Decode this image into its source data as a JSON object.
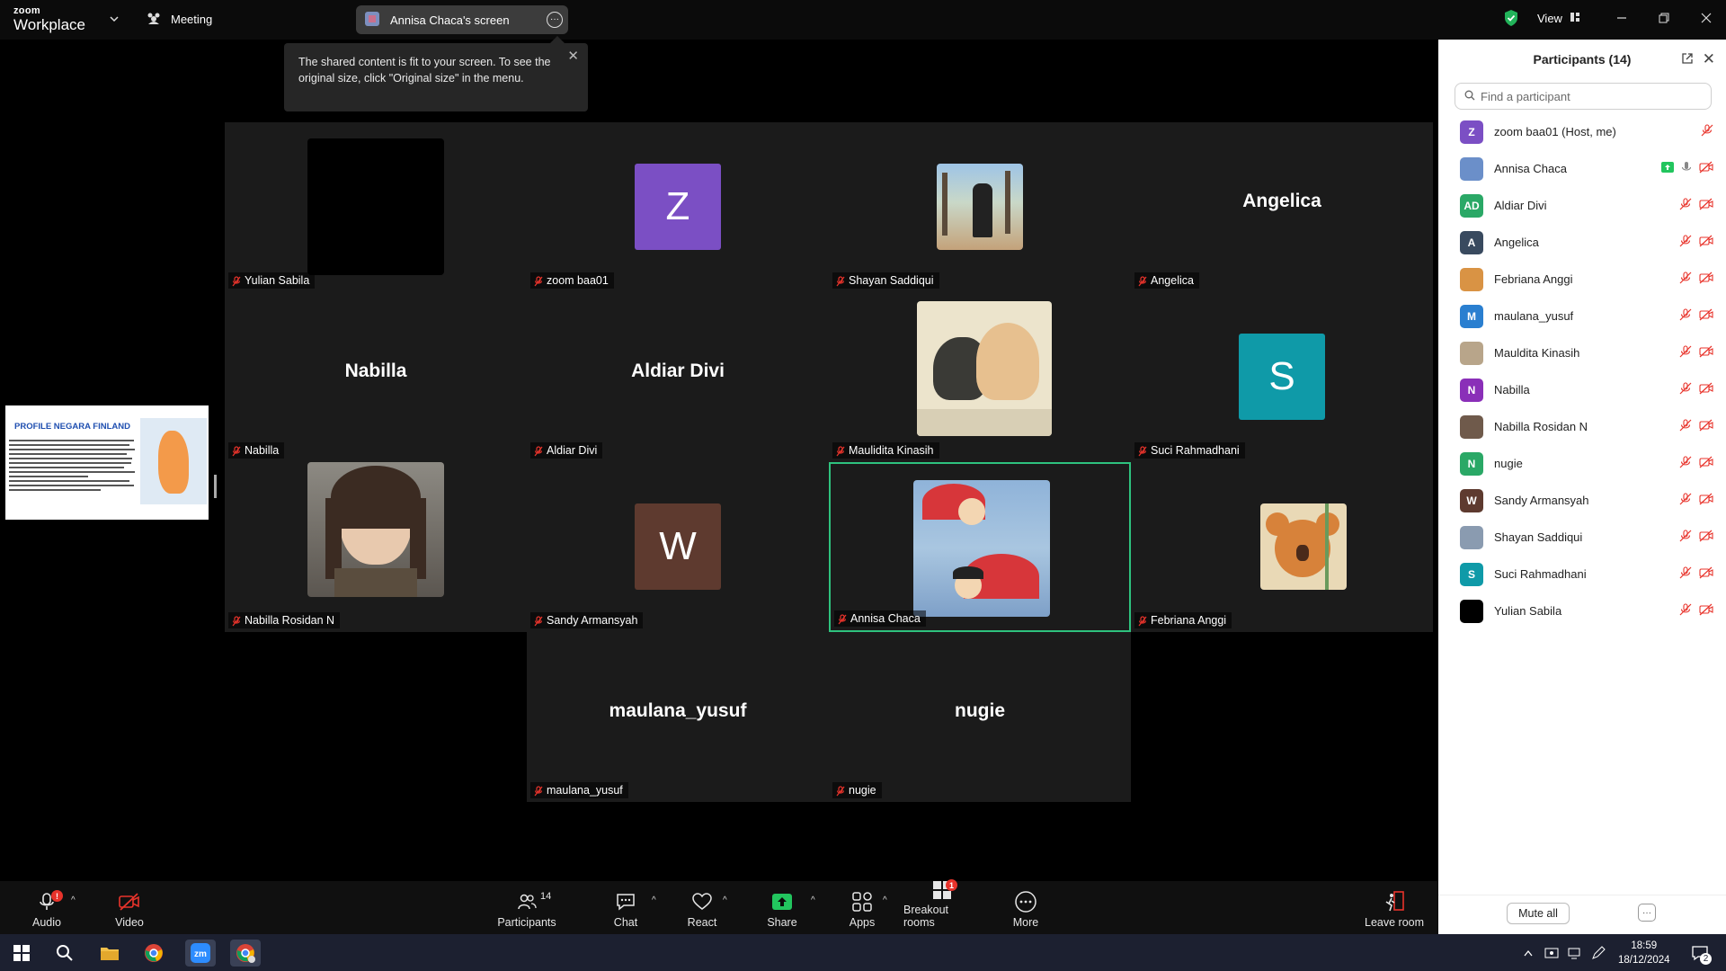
{
  "app": {
    "logo_line1": "zoom",
    "logo_line2": "Workplace",
    "meeting_label": "Meeting",
    "screen_share_label": "Annisa Chaca's screen",
    "view_label": "View"
  },
  "tooltip": {
    "text": "The shared content is fit to your screen. To see the original size, click \"Original size\" in the menu."
  },
  "shared_thumb": {
    "title": "PROFILE NEGARA FINLAND"
  },
  "tiles": [
    {
      "name": "Yulian Sabila",
      "display": "",
      "kind": "black"
    },
    {
      "name": "zoom baa01",
      "display": "Z",
      "kind": "letter",
      "color": "#7b4fc4"
    },
    {
      "name": "Shayan Saddiqui",
      "display": "",
      "kind": "photo"
    },
    {
      "name": "Angelica",
      "display": "Angelica",
      "kind": "text"
    },
    {
      "name": "Nabilla",
      "display": "Nabilla",
      "kind": "text"
    },
    {
      "name": "Aldiar Divi",
      "display": "Aldiar Divi",
      "kind": "text"
    },
    {
      "name": "Maulidita Kinasih",
      "display": "",
      "kind": "photo"
    },
    {
      "name": "Suci Rahmadhani",
      "display": "S",
      "kind": "letter",
      "color": "#0f9aa8"
    },
    {
      "name": "Nabilla Rosidan N",
      "display": "",
      "kind": "photo"
    },
    {
      "name": "Sandy Armansyah",
      "display": "W",
      "kind": "letter",
      "color": "#5e3a2f"
    },
    {
      "name": "Annisa Chaca",
      "display": "",
      "kind": "photo",
      "active": true
    },
    {
      "name": "Febriana Anggi",
      "display": "",
      "kind": "photo"
    },
    {
      "name": "maulana_yusuf",
      "display": "maulana_yusuf",
      "kind": "text"
    },
    {
      "name": "nugie",
      "display": "nugie",
      "kind": "text"
    }
  ],
  "participants": {
    "title": "Participants (14)",
    "search_placeholder": "Find a participant",
    "mute_all_label": "Mute all",
    "more_label": "···",
    "list": [
      {
        "name": "zoom baa01 (Host, me)",
        "initials": "Z",
        "color": "#7b4fc4"
      },
      {
        "name": "Annisa Chaca",
        "initials": "",
        "color": "#6b8fc9"
      },
      {
        "name": "Aldiar Divi",
        "initials": "AD",
        "color": "#2aa866"
      },
      {
        "name": "Angelica",
        "initials": "A",
        "color": "#394a5f"
      },
      {
        "name": "Febriana Anggi",
        "initials": "",
        "color": "#d99344"
      },
      {
        "name": "maulana_yusuf",
        "initials": "M",
        "color": "#2a7fd0"
      },
      {
        "name": "Mauldita Kinasih",
        "initials": "",
        "color": "#b8a58a"
      },
      {
        "name": "Nabilla",
        "initials": "N",
        "color": "#8a2fb8"
      },
      {
        "name": "Nabilla Rosidan N",
        "initials": "",
        "color": "#6f5a4b"
      },
      {
        "name": "nugie",
        "initials": "N",
        "color": "#2aa866"
      },
      {
        "name": "Sandy Armansyah",
        "initials": "W",
        "color": "#5e3a2f"
      },
      {
        "name": "Shayan Saddiqui",
        "initials": "",
        "color": "#8a9bb0"
      },
      {
        "name": "Suci Rahmadhani",
        "initials": "S",
        "color": "#0f9aa8"
      },
      {
        "name": "Yulian Sabila",
        "initials": "",
        "color": "#000000"
      }
    ]
  },
  "toolbar": {
    "audio": "Audio",
    "video": "Video",
    "participants": "Participants",
    "participants_count": "14",
    "chat": "Chat",
    "react": "React",
    "share": "Share",
    "apps": "Apps",
    "breakout": "Breakout rooms",
    "breakout_badge": "1",
    "more": "More",
    "leave": "Leave room",
    "audio_badge": "!"
  },
  "taskbar": {
    "time": "18:59",
    "date": "18/12/2024",
    "notif_count": "2"
  },
  "colors": {
    "accent_green": "#2ec27e",
    "mute_red": "#e8332b",
    "share_green": "#22c55e"
  }
}
